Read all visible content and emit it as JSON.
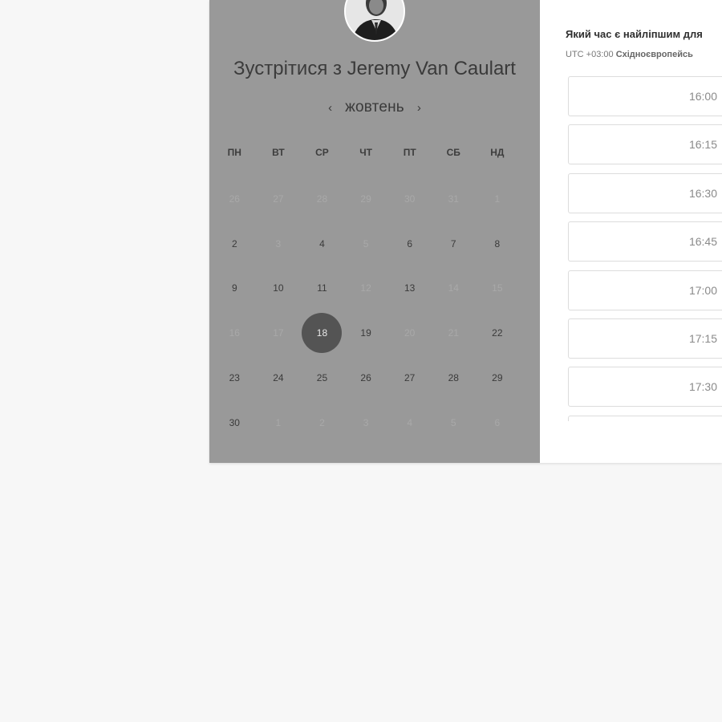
{
  "booking": {
    "title_prefix": "Зустрітися з",
    "host_name": "Jeremy Van Caulart",
    "month": "жовтень",
    "prev_month": "‹",
    "next_month": "›",
    "weekdays": [
      "ПН",
      "ВТ",
      "СР",
      "ЧТ",
      "ПТ",
      "СБ",
      "НД"
    ],
    "days": [
      {
        "label": "26",
        "state": "muted"
      },
      {
        "label": "27",
        "state": "muted"
      },
      {
        "label": "28",
        "state": "muted"
      },
      {
        "label": "29",
        "state": "muted"
      },
      {
        "label": "30",
        "state": "muted"
      },
      {
        "label": "31",
        "state": "muted"
      },
      {
        "label": "1",
        "state": "muted"
      },
      {
        "label": "2",
        "state": "available"
      },
      {
        "label": "3",
        "state": "muted"
      },
      {
        "label": "4",
        "state": "available"
      },
      {
        "label": "5",
        "state": "muted"
      },
      {
        "label": "6",
        "state": "available"
      },
      {
        "label": "7",
        "state": "available"
      },
      {
        "label": "8",
        "state": "available"
      },
      {
        "label": "9",
        "state": "available"
      },
      {
        "label": "10",
        "state": "available"
      },
      {
        "label": "11",
        "state": "available"
      },
      {
        "label": "12",
        "state": "muted"
      },
      {
        "label": "13",
        "state": "available"
      },
      {
        "label": "14",
        "state": "muted"
      },
      {
        "label": "15",
        "state": "muted"
      },
      {
        "label": "16",
        "state": "muted"
      },
      {
        "label": "17",
        "state": "muted"
      },
      {
        "label": "18",
        "state": "selected"
      },
      {
        "label": "19",
        "state": "available"
      },
      {
        "label": "20",
        "state": "muted"
      },
      {
        "label": "21",
        "state": "muted"
      },
      {
        "label": "22",
        "state": "available"
      },
      {
        "label": "23",
        "state": "available"
      },
      {
        "label": "24",
        "state": "available"
      },
      {
        "label": "25",
        "state": "available"
      },
      {
        "label": "26",
        "state": "available"
      },
      {
        "label": "27",
        "state": "available"
      },
      {
        "label": "28",
        "state": "available"
      },
      {
        "label": "29",
        "state": "available"
      },
      {
        "label": "30",
        "state": "available"
      },
      {
        "label": "1",
        "state": "muted"
      },
      {
        "label": "2",
        "state": "muted"
      },
      {
        "label": "3",
        "state": "muted"
      },
      {
        "label": "4",
        "state": "muted"
      },
      {
        "label": "5",
        "state": "muted"
      },
      {
        "label": "6",
        "state": "muted"
      }
    ]
  },
  "times": {
    "question": "Який час є найліпшим для",
    "tz_offset": "UTC +03:00",
    "tz_name": "Східноєвропейсь",
    "slots": [
      "16:00",
      "16:15",
      "16:30",
      "16:45",
      "17:00",
      "17:15",
      "17:30",
      ""
    ]
  },
  "colors": {
    "overlay": "#999999",
    "selected_day": "#545454",
    "page_background": "#f7f7f7"
  },
  "icons": {
    "avatar": "host-avatar-photo",
    "prev": "chevron-left-icon",
    "next": "chevron-right-icon"
  }
}
